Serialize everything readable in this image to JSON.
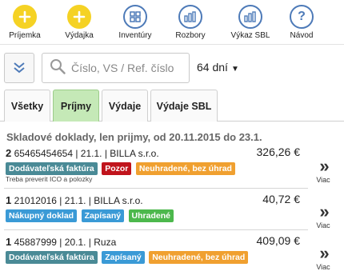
{
  "toolbar": {
    "items": [
      {
        "label": "Príjemka",
        "icon": "plus-icon"
      },
      {
        "label": "Výdajka",
        "icon": "plus-icon"
      },
      {
        "label": "Inventúry",
        "icon": "grid-icon"
      },
      {
        "label": "Rozbory",
        "icon": "bar-chart-icon"
      },
      {
        "label": "Výkaz SBL",
        "icon": "bar-chart-icon"
      },
      {
        "label": "Návod",
        "icon": "help-icon"
      }
    ]
  },
  "search": {
    "placeholder": "Číslo, VS / Ref. číslo",
    "days_label": "64 dní"
  },
  "tabs": [
    {
      "label": "Všetky"
    },
    {
      "label": "Príjmy"
    },
    {
      "label": "Výdaje"
    },
    {
      "label": "Výdaje SBL"
    }
  ],
  "list_title": "Skladové doklady, len prijmy, od 20.11.2015 do 23.1.",
  "documents": [
    {
      "count": "2",
      "number": "65465454654",
      "date": "21.1.",
      "partner": "BILLA s.r.o.",
      "amount": "326,26 €",
      "badges": [
        {
          "text": "Dodávateľská faktúra",
          "color": "#4a8a96"
        },
        {
          "text": "Pozor",
          "color": "#c0141c"
        },
        {
          "text": "Neuhradené, bez úhrad",
          "color": "#f0a030"
        }
      ],
      "note": "Treba preverit ICO a polozky",
      "more_label": "Viac"
    },
    {
      "count": "1",
      "number": "21012016",
      "date": "21.1.",
      "partner": "BILLA s.r.o.",
      "amount": "40,72 €",
      "badges": [
        {
          "text": "Nákupný doklad",
          "color": "#3a9ad6"
        },
        {
          "text": "Zapísaný",
          "color": "#3a9ad6"
        },
        {
          "text": "Uhradené",
          "color": "#4cb84c"
        }
      ],
      "note": "",
      "more_label": "Viac"
    },
    {
      "count": "1",
      "number": "45887999",
      "date": "20.1.",
      "partner": "Ruza",
      "amount": "409,09 €",
      "badges": [
        {
          "text": "Dodávateľská faktúra",
          "color": "#4a8a96"
        },
        {
          "text": "Zapísaný",
          "color": "#3a9ad6"
        },
        {
          "text": "Neuhradené, bez úhrad",
          "color": "#f0a030"
        }
      ],
      "note": "",
      "more_label": "Viac"
    }
  ],
  "colors": {
    "accent_blue": "#4d7ab8",
    "accent_yellow": "#f5d224",
    "active_tab": "#c5e9b7"
  }
}
